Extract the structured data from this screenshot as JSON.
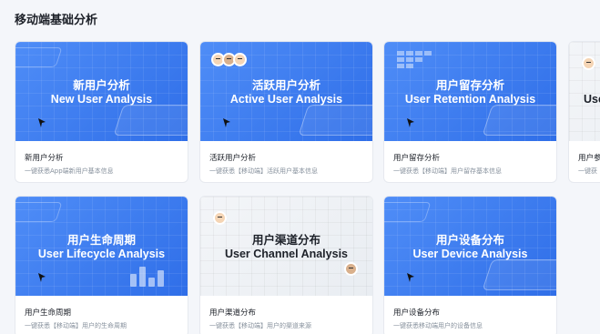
{
  "section": {
    "title": "移动端基础分析"
  },
  "cards": [
    {
      "title_cn": "新用户分析",
      "title_en": "New User Analysis",
      "name": "新用户分析",
      "desc": "一键获悉App端新用户基本信息"
    },
    {
      "title_cn": "活跃用户分析",
      "title_en": "Active User Analysis",
      "name": "活跃用户分析",
      "desc": "一键获悉【移动端】活跃用户基本信息"
    },
    {
      "title_cn": "用户留存分析",
      "title_en": "User Retention Analysis",
      "name": "用户留存分析",
      "desc": "一键获悉【移动端】用户留存基本信息"
    },
    {
      "title_cn": "",
      "title_en": "Use",
      "name": "用户参",
      "desc": "一键获"
    },
    {
      "title_cn": "用户生命周期",
      "title_en": "User Lifecycle Analysis",
      "name": "用户生命周期",
      "desc": "一键获悉【移动端】用户的生命周期"
    },
    {
      "title_cn": "用户渠道分布",
      "title_en": "User Channel Analysis",
      "name": "用户渠道分布",
      "desc": "一键获悉【移动端】用户的渠道来源"
    },
    {
      "title_cn": "用户设备分布",
      "title_en": "User Device Analysis",
      "name": "用户设备分布",
      "desc": "一键获悉移动端用户的设备信息"
    }
  ],
  "icons": {
    "cursor": "cursor-arrow-icon",
    "avatar": "user-avatar-icon"
  },
  "colors": {
    "banner_blue": "#2f6ee8",
    "banner_light": "#eef1f5",
    "text_primary": "#1d2129",
    "text_secondary": "#86909c"
  }
}
